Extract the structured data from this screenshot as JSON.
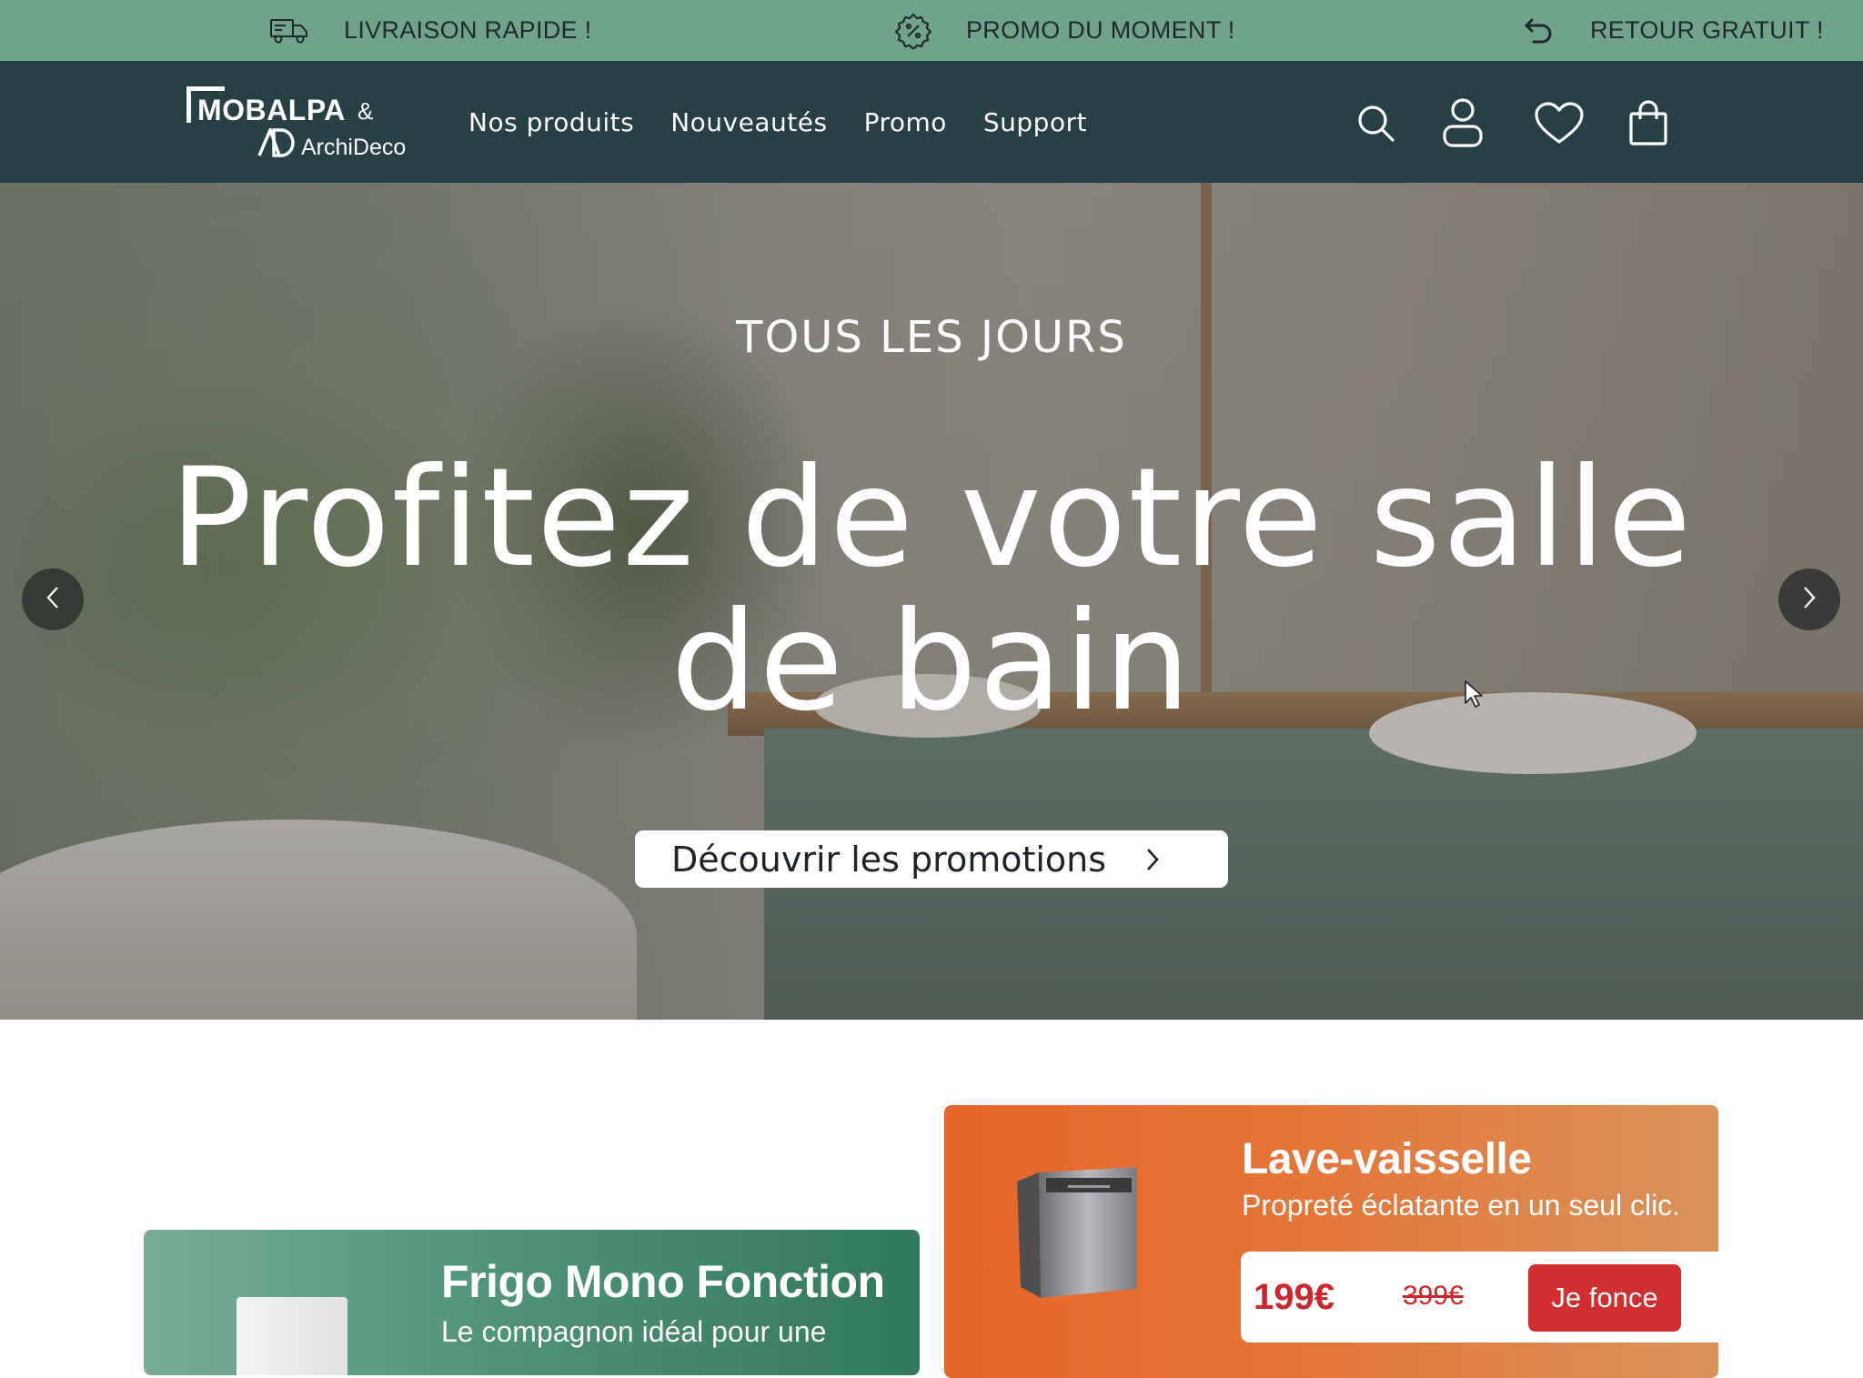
{
  "promo_bar": {
    "items": [
      {
        "label": "LIVRAISON RAPIDE !",
        "icon": "truck-icon"
      },
      {
        "label": "PROMO DU MOMENT !",
        "icon": "percent-badge-icon"
      },
      {
        "label": "RETOUR GRATUIT !",
        "icon": "return-arrow-icon"
      }
    ]
  },
  "header": {
    "logo": {
      "brand": "MOBALPA",
      "amp": "&",
      "sub": "ArchiDeco"
    },
    "nav": [
      "Nos produits",
      "Nouveautés",
      "Promo",
      "Support"
    ],
    "icons": [
      "search-icon",
      "user-icon",
      "heart-icon",
      "bag-icon"
    ]
  },
  "hero": {
    "kicker": "TOUS LES JOURS",
    "title": "Profitez de votre salle de bain",
    "cta": "Découvrir les promotions"
  },
  "cards": {
    "frigo": {
      "title": "Frigo Mono Fonction",
      "subtitle": "Le compagnon idéal pour une"
    },
    "lave_vaisselle": {
      "title": "Lave-vaisselle",
      "subtitle": "Propreté éclatante en un seul clic.",
      "price_now": "199€",
      "price_old": "399€",
      "button": "Je fonce"
    }
  },
  "colors": {
    "promo_bar": "#6fa48a",
    "header": "#264045",
    "frigo_card": "#4f9479",
    "lave_card": "#e66528",
    "price_red": "#c8282e",
    "button_red": "#d22d2f"
  }
}
